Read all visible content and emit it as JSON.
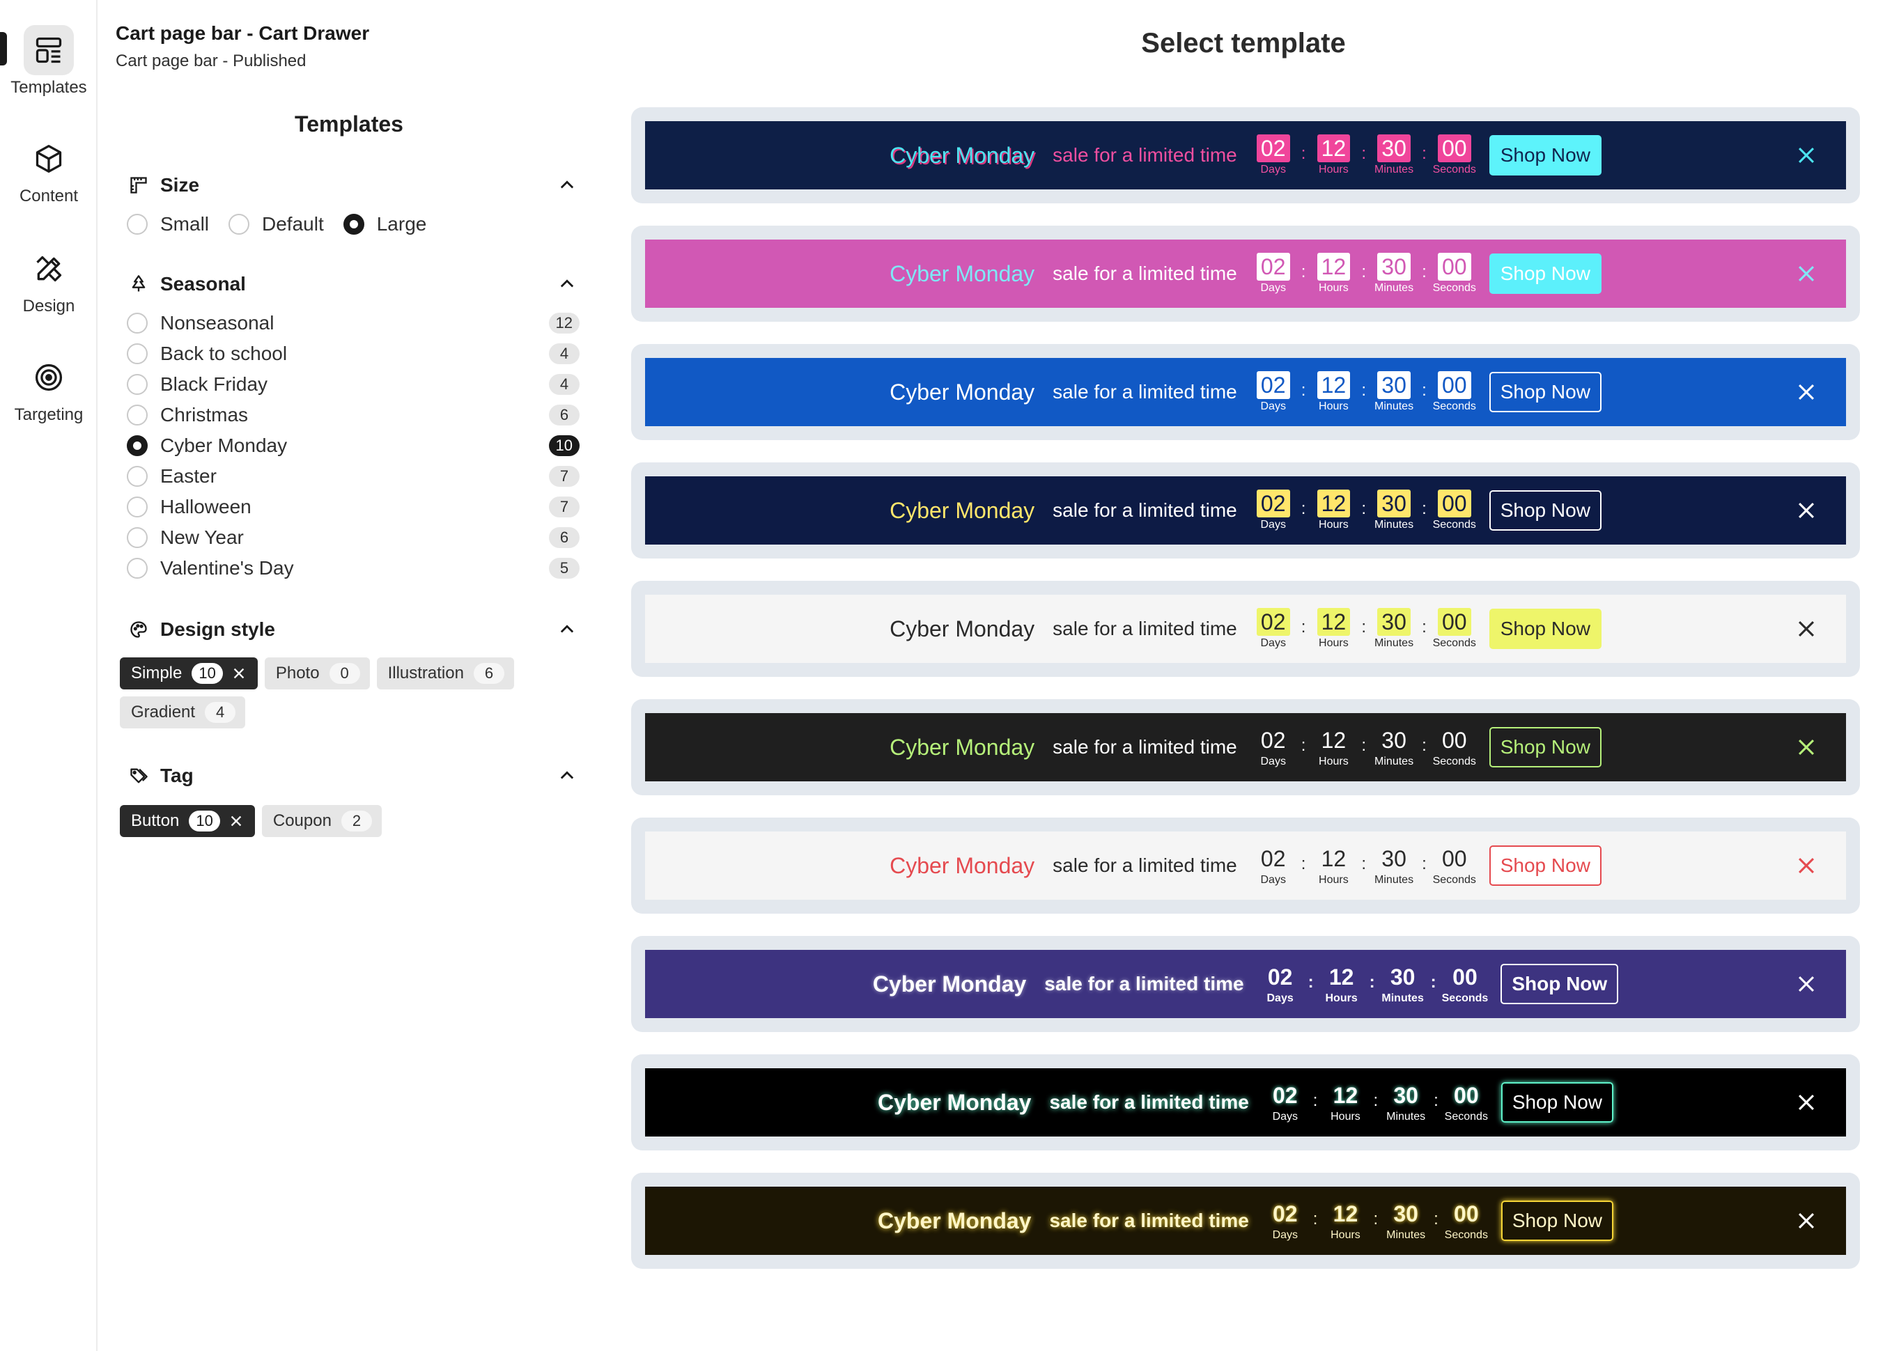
{
  "rail": {
    "items": [
      {
        "label": "Templates",
        "icon": "templates-icon",
        "active": true
      },
      {
        "label": "Content",
        "icon": "cube-icon",
        "active": false
      },
      {
        "label": "Design",
        "icon": "design-tools-icon",
        "active": false
      },
      {
        "label": "Targeting",
        "icon": "target-icon",
        "active": false
      }
    ]
  },
  "header": {
    "title": "Cart page bar - Cart Drawer",
    "subtitle": "Cart page bar  -  Published"
  },
  "panel": {
    "title": "Templates",
    "size": {
      "title": "Size",
      "options": [
        "Small",
        "Default",
        "Large"
      ],
      "selected": "Large"
    },
    "seasonal": {
      "title": "Seasonal",
      "items": [
        {
          "label": "Nonseasonal",
          "count": "12"
        },
        {
          "label": "Back to school",
          "count": "4"
        },
        {
          "label": "Black Friday",
          "count": "4"
        },
        {
          "label": "Christmas",
          "count": "6"
        },
        {
          "label": "Cyber Monday",
          "count": "10",
          "selected": true
        },
        {
          "label": "Easter",
          "count": "7"
        },
        {
          "label": "Halloween",
          "count": "7"
        },
        {
          "label": "New Year",
          "count": "6"
        },
        {
          "label": "Valentine's Day",
          "count": "5"
        }
      ]
    },
    "design_style": {
      "title": "Design style",
      "chips": [
        {
          "label": "Simple",
          "count": "10",
          "selected": true
        },
        {
          "label": "Photo",
          "count": "0"
        },
        {
          "label": "Illustration",
          "count": "6"
        },
        {
          "label": "Gradient",
          "count": "4"
        }
      ]
    },
    "tag": {
      "title": "Tag",
      "chips": [
        {
          "label": "Button",
          "count": "10",
          "selected": true
        },
        {
          "label": "Coupon",
          "count": "2"
        }
      ]
    }
  },
  "main": {
    "title": "Select template",
    "template": {
      "title": "Cyber Monday",
      "subtitle": "sale for a limited time",
      "days": "02",
      "hours": "12",
      "minutes": "30",
      "seconds": "00",
      "days_label": "Days",
      "hours_label": "Hours",
      "minutes_label": "Minutes",
      "seconds_label": "Seconds",
      "button": "Shop Now"
    },
    "templates": [
      {
        "theme": "t1",
        "close_color": "#4de4f0"
      },
      {
        "theme": "t2",
        "close_color": "#7fe8f6"
      },
      {
        "theme": "t3",
        "close_color": "#ffffff"
      },
      {
        "theme": "t4",
        "close_color": "#ffffff"
      },
      {
        "theme": "t5",
        "close_color": "#2a2a2a"
      },
      {
        "theme": "t6",
        "close_color": "#b6f07a"
      },
      {
        "theme": "t7",
        "close_color": "#e54a4f"
      },
      {
        "theme": "t8",
        "close_color": "#ffffff"
      },
      {
        "theme": "t9",
        "close_color": "#ffffff"
      },
      {
        "theme": "t10",
        "close_color": "#ffffff"
      }
    ]
  }
}
